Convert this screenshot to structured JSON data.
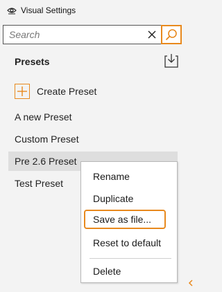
{
  "window": {
    "title": "Visual Settings",
    "icon": "eye-icon"
  },
  "search": {
    "placeholder": "Search",
    "value": ""
  },
  "presets": {
    "heading": "Presets",
    "create_label": "Create Preset",
    "items": [
      {
        "label": "A new Preset",
        "selected": false
      },
      {
        "label": "Custom Preset",
        "selected": false
      },
      {
        "label": "Pre 2.6 Preset",
        "selected": true
      },
      {
        "label": "Test Preset",
        "selected": false
      }
    ]
  },
  "context_menu": {
    "items": [
      {
        "label": "Rename"
      },
      {
        "label": "Duplicate"
      },
      {
        "label": "Save as file...",
        "focused": true
      },
      {
        "label": "Reset to default"
      },
      {
        "label": "Delete"
      }
    ]
  },
  "colors": {
    "accent": "#e8891d",
    "background": "#f3f3f3",
    "selected_row": "#dedede"
  }
}
